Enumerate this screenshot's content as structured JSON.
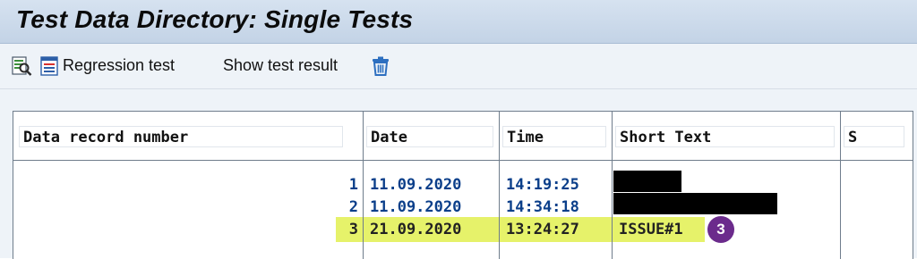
{
  "window": {
    "title": "Test Data Directory: Single Tests"
  },
  "toolbar": {
    "icons": [
      "search-doc-icon",
      "regression-list-icon",
      "trash-icon"
    ],
    "regression_label": "Regression test",
    "show_result_label": "Show test result"
  },
  "table": {
    "columns": [
      "Data record number",
      "Date",
      "Time",
      "Short Text",
      "S"
    ],
    "rows": [
      {
        "number": "1",
        "date": "11.09.2020",
        "time": "14:19:25",
        "short_text": "",
        "redacted": true
      },
      {
        "number": "2",
        "date": "11.09.2020",
        "time": "14:34:18",
        "short_text": "",
        "redacted": true
      },
      {
        "number": "3",
        "date": "21.09.2020",
        "time": "13:24:27",
        "short_text": "ISSUE#1",
        "redacted": false,
        "highlighted": true
      }
    ],
    "callout": "3"
  },
  "colors": {
    "title_bar": "#c9d7e8",
    "value_text": "#0b3f8a",
    "highlight": "#e6f26a",
    "callout": "#6b2b8c"
  }
}
